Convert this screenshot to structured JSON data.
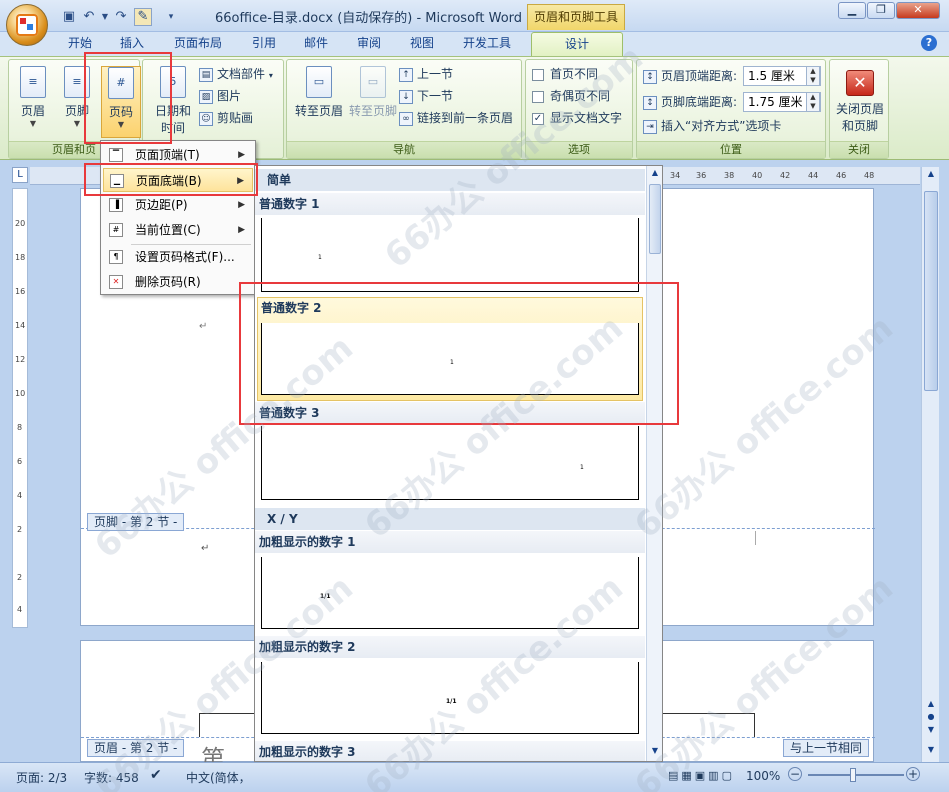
{
  "window": {
    "title": "66office-目录.docx (自动保存的) - Microsoft Word",
    "tool_tab_title": "页眉和页脚工具"
  },
  "quick_access": {
    "save_icon": "save-icon",
    "undo_icon": "undo-icon",
    "redo_icon": "redo-icon",
    "custom_icon": "toolbox-icon"
  },
  "tabs": [
    "开始",
    "插入",
    "页面布局",
    "引用",
    "邮件",
    "审阅",
    "视图",
    "开发工具",
    "设计"
  ],
  "active_tab": "设计",
  "ribbon": {
    "group_header_footer": {
      "label": "页眉和页",
      "header": "页眉",
      "footer": "页脚",
      "page_number": "页码"
    },
    "group_insert": {
      "date_time_1": "日期和",
      "date_time_2": "时间",
      "doc_parts": "文档部件",
      "picture": "图片",
      "clipart": "剪贴画"
    },
    "group_nav": {
      "label": "导航",
      "goto_header": "转至页眉",
      "goto_footer": "转至页脚",
      "prev_section": "上一节",
      "next_section": "下一节",
      "link_prev": "链接到前一条页眉"
    },
    "group_options": {
      "label": "选项",
      "diff_first": "首页不同",
      "diff_odd_even": "奇偶页不同",
      "show_doc_text": "显示文档文字"
    },
    "group_position": {
      "label": "位置",
      "header_dist_label": "页眉顶端距离:",
      "header_dist_value": "1.5 厘米",
      "footer_dist_label": "页脚底端距离:",
      "footer_dist_value": "1.75 厘米",
      "insert_align_tab": "插入“对齐方式”选项卡"
    },
    "group_close": {
      "label": "关闭",
      "close_1": "关闭页眉",
      "close_2": "和页脚"
    }
  },
  "ruler": {
    "h_numbers": [
      "34",
      "36",
      "38",
      "40",
      "42",
      "44",
      "46",
      "48"
    ],
    "v_numbers": [
      "20",
      "18",
      "16",
      "14",
      "12",
      "10",
      "8",
      "6",
      "4",
      "2",
      "2",
      "4"
    ],
    "corner": "L"
  },
  "menu": {
    "items": [
      {
        "label": "页面顶端(T)",
        "sub": true
      },
      {
        "label": "页面底端(B)",
        "sub": true
      },
      {
        "label": "页边距(P)",
        "sub": true
      },
      {
        "label": "当前位置(C)",
        "sub": true
      },
      {
        "label": "设置页码格式(F)...",
        "sub": false
      },
      {
        "label": "删除页码(R)",
        "sub": false
      }
    ],
    "highlighted": "页面底端(B)"
  },
  "gallery": {
    "section_simple": "简单",
    "item1": "普通数字 1",
    "item2": "普通数字 2",
    "item3": "普通数字 3",
    "section_xy": "X / Y",
    "item4": "加粗显示的数字 1",
    "item5": "加粗显示的数字 2",
    "item6": "加粗显示的数字 3",
    "num_simple": "1",
    "num_xy": "1/1"
  },
  "document": {
    "footer_tag": "页脚 - 第 2 节 -",
    "header_tag": "页眉 - 第 2 节 -",
    "same_as_prev": "与上一节相同",
    "big_text": "第",
    "para_mark": "↵"
  },
  "status": {
    "page": "页面: 2/3",
    "words": "字数: 458",
    "lang": "中文(简体，",
    "zoom": "100%"
  },
  "watermark": "66办公 office.com",
  "colors": {
    "highlight_red": "#e8393c",
    "design_tab": "#e2f1c3"
  }
}
